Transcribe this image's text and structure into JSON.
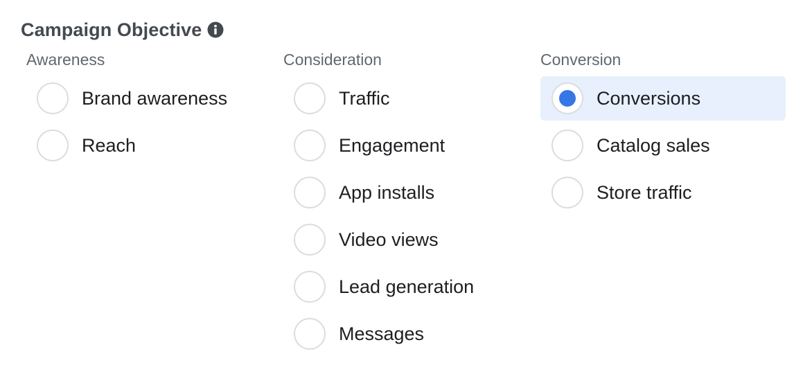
{
  "header": {
    "title": "Campaign Objective",
    "info_icon": "info-circle-icon"
  },
  "colors": {
    "accent": "#3578e5",
    "selected_background": "#e7f0fc",
    "radio_border": "#dadde1",
    "heading_text": "#606770",
    "title_text": "#444950"
  },
  "columns": [
    {
      "heading": "Awareness",
      "options": [
        {
          "label": "Brand awareness",
          "selected": false
        },
        {
          "label": "Reach",
          "selected": false
        }
      ]
    },
    {
      "heading": "Consideration",
      "options": [
        {
          "label": "Traffic",
          "selected": false
        },
        {
          "label": "Engagement",
          "selected": false
        },
        {
          "label": "App installs",
          "selected": false
        },
        {
          "label": "Video views",
          "selected": false
        },
        {
          "label": "Lead generation",
          "selected": false
        },
        {
          "label": "Messages",
          "selected": false
        }
      ]
    },
    {
      "heading": "Conversion",
      "options": [
        {
          "label": "Conversions",
          "selected": true
        },
        {
          "label": "Catalog sales",
          "selected": false
        },
        {
          "label": "Store traffic",
          "selected": false
        }
      ]
    }
  ]
}
